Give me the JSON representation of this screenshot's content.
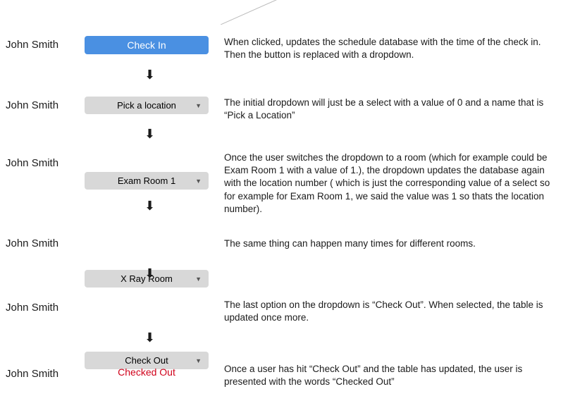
{
  "person_name": "John Smith",
  "colors": {
    "primary": "#4A90E2",
    "grey": "#D8D8D8",
    "red": "#D0021B"
  },
  "rows": [
    {
      "kind": "button",
      "label": "Check In",
      "desc": "When clicked, updates the schedule database with the time of the check in. Then the button is replaced with a dropdown."
    },
    {
      "kind": "dropdown",
      "label": "Pick a location",
      "desc": "The initial dropdown will just be a select with a value of 0 and a name that is “Pick a Location”"
    },
    {
      "kind": "dropdown",
      "label": "Exam Room 1",
      "desc": "Once the user switches the dropdown to a room (which for example could be Exam Room 1  with a value of 1.), the dropdown updates the database again with the location number ( which is just the corresponding value of a select so for example for Exam Room 1, we said the value was 1 so thats the location number)."
    },
    {
      "kind": "dropdown",
      "label": "X Ray Room",
      "desc": "The same thing can happen many times for different rooms."
    },
    {
      "kind": "dropdown",
      "label": "Check Out",
      "desc": "The last option on the dropdown is “Check Out”. When selected, the table is updated once more."
    },
    {
      "kind": "status",
      "label": "Checked Out",
      "desc": "Once a user has hit “Check Out” and the table has updated, the user is presented with the words “Checked Out”"
    }
  ],
  "caret_glyph": "▼",
  "arrow_glyph": "⬇"
}
